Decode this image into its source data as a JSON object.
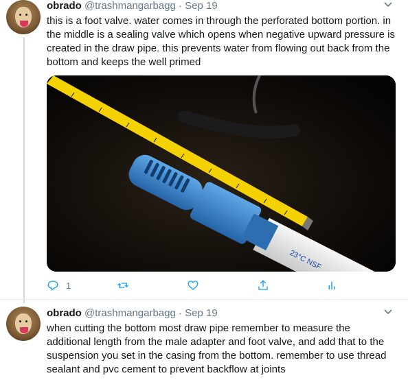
{
  "tweets": [
    {
      "name": "obrado",
      "handle": "@trashmangarbagg",
      "separator": "·",
      "date": "Sep 19",
      "text": "this is a foot valve. water comes in through the perforated bottom portion. in the middle is a sealing valve which opens when negative upward pressure is created in the draw pipe. this prevents water from flowing out back from the bottom and keeps the well primed",
      "media": {
        "tape_label": "",
        "pipe_print": "23°C NSF"
      },
      "actions": {
        "reply_count": "1"
      }
    },
    {
      "name": "obrado",
      "handle": "@trashmangarbagg",
      "separator": "·",
      "date": "Sep 19",
      "text": "when cutting the bottom most draw pipe remember to measure the additional length from the male adapter and foot valve, and add that to the suspension you set in the casing from the bottom. remember to use thread sealant and pvc cement to prevent backflow at joints"
    }
  ],
  "icons": {
    "reply": "reply-icon",
    "retweet": "retweet-icon",
    "like": "heart-icon",
    "share": "share-icon",
    "analytics": "analytics-icon",
    "more": "chevron-down-icon"
  },
  "colors": {
    "text": "#14171a",
    "secondary": "#657786",
    "icon": "#1da1f2",
    "thread_line": "#cfd9de",
    "tape_yellow": "#f4d100",
    "valve_blue": "#3a86c8"
  }
}
